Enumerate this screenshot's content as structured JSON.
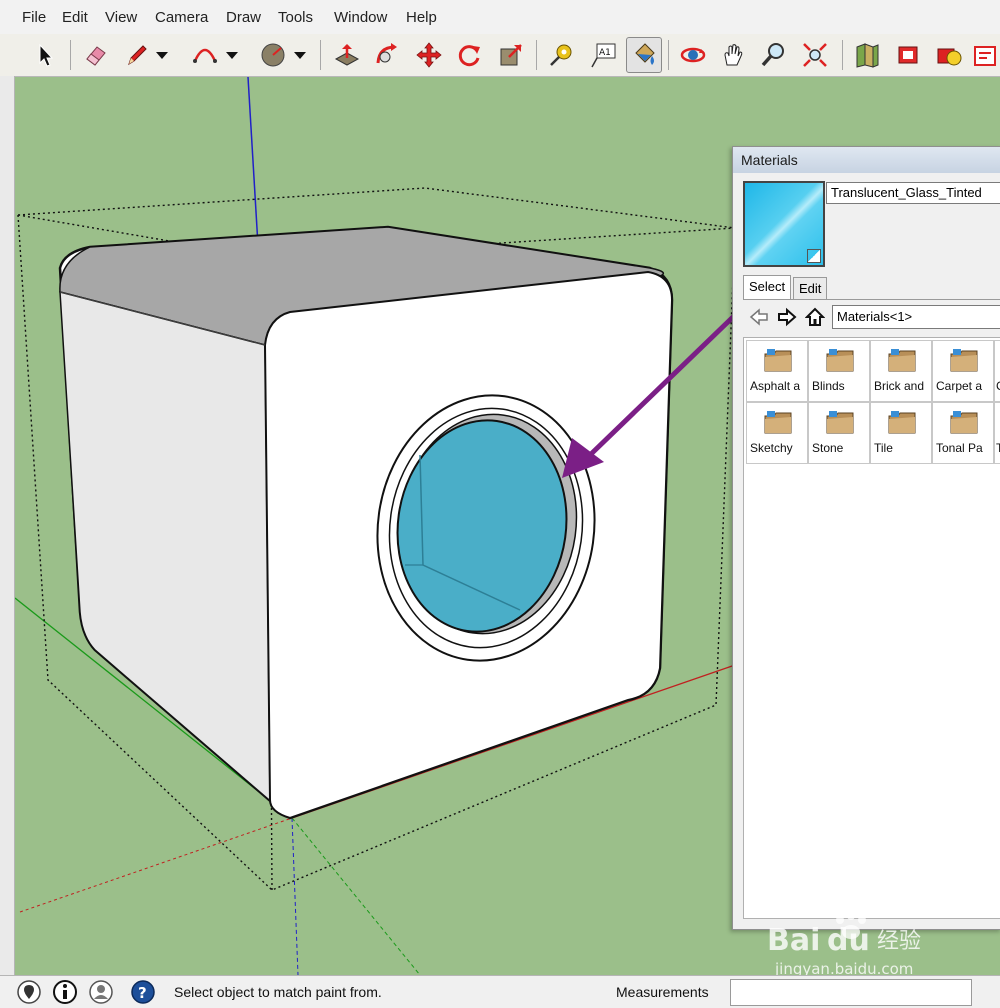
{
  "menu": [
    "File",
    "Edit",
    "View",
    "Camera",
    "Draw",
    "Tools",
    "Window",
    "Help"
  ],
  "toolbar": {
    "tools": [
      "select-icon",
      "eraser-icon",
      "pencil-icon",
      "arc-icon",
      "circle-icon",
      "push-pull-icon",
      "follow-me-icon",
      "move-icon",
      "rotate-icon",
      "scale-icon",
      "tape-measure-icon",
      "text-icon",
      "paint-bucket-icon",
      "orbit-icon",
      "pan-icon",
      "zoom-icon",
      "zoom-extents-icon",
      "get-models-icon",
      "share-model-icon",
      "components-icon",
      "extension-icon"
    ],
    "active_tool": "paint-bucket-icon",
    "text_tool_glyph": "A1"
  },
  "materials": {
    "title": "Materials",
    "current_name": "Translucent_Glass_Tinted",
    "swatch_color": "#2cc0ec",
    "tabs": [
      "Select",
      "Edit"
    ],
    "active_tab": "Select",
    "library": "Materials<1>",
    "folders": [
      {
        "label": "Asphalt a"
      },
      {
        "label": "Blinds"
      },
      {
        "label": "Brick and"
      },
      {
        "label": "Carpet a"
      },
      {
        "label": "C"
      },
      {
        "label": "Sketchy"
      },
      {
        "label": "Stone"
      },
      {
        "label": "Tile"
      },
      {
        "label": "Tonal Pa"
      },
      {
        "label": "T"
      }
    ]
  },
  "status": {
    "message": "Select object to match paint from.",
    "measurements_label": "Measurements",
    "measurements_value": ""
  },
  "colors": {
    "viewport_bg": "#9bbf8a",
    "glass": "#4aaec8",
    "arrow": "#7b1f86",
    "blue_axis": "#2020c8",
    "green_axis": "#1a9a1a",
    "red_axis": "#c02020"
  },
  "watermark": {
    "brand": "Bai du 经验",
    "url": "jingyan.baidu.com"
  }
}
